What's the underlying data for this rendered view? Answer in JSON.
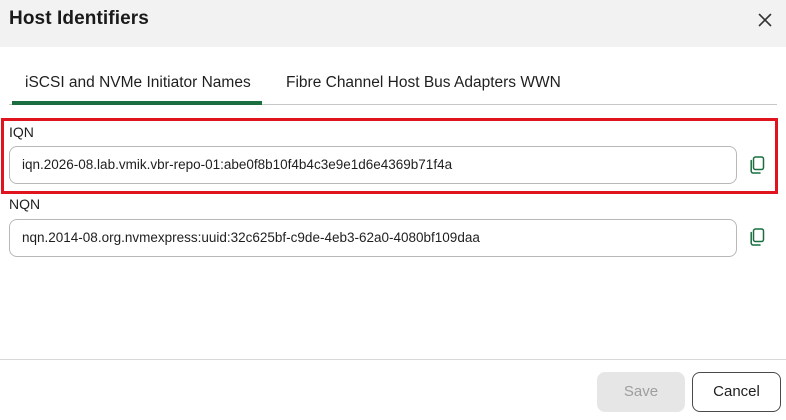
{
  "dialog": {
    "title": "Host Identifiers",
    "close_icon": "close-icon"
  },
  "tabs": [
    {
      "label": "iSCSI and NVMe Initiator Names",
      "active": true
    },
    {
      "label": "Fibre Channel Host Bus Adapters WWN",
      "active": false
    }
  ],
  "fields": {
    "iqn": {
      "label": "IQN",
      "value": "iqn.2026-08.lab.vmik.vbr-repo-01:abe0f8b10f4b4c3e9e1d6e4369b71f4a",
      "copy_icon": "copy-icon"
    },
    "nqn": {
      "label": "NQN",
      "value": "nqn.2014-08.org.nvmexpress:uuid:32c625bf-c9de-4eb3-62a0-4080bf109daa",
      "copy_icon": "copy-icon"
    }
  },
  "footer": {
    "save_label": "Save",
    "cancel_label": "Cancel",
    "save_disabled": true
  },
  "colors": {
    "accent": "#1a6e3f",
    "highlight": "#e0141e",
    "header_bg": "#f2f2f2",
    "disabled_bg": "#e6e6e6"
  }
}
